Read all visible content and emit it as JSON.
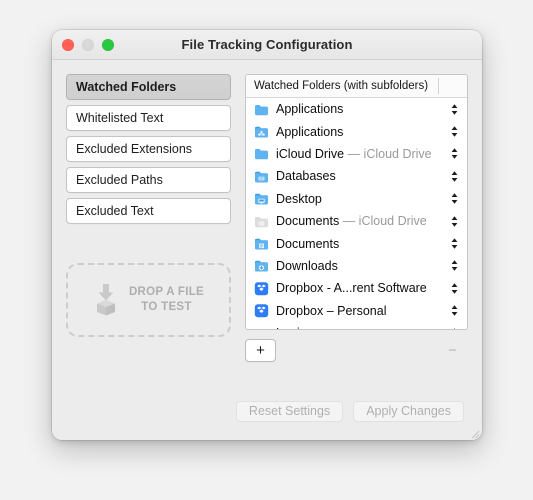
{
  "window": {
    "title": "File Tracking Configuration",
    "traffic_lights": [
      {
        "name": "close",
        "color": "#ff5f57"
      },
      {
        "name": "minimize",
        "color": "#d8d8d8"
      },
      {
        "name": "zoom",
        "color": "#28c840"
      }
    ]
  },
  "sidebar": {
    "items": [
      {
        "label": "Watched Folders",
        "selected": true
      },
      {
        "label": "Whitelisted Text",
        "selected": false
      },
      {
        "label": "Excluded Extensions",
        "selected": false
      },
      {
        "label": "Excluded Paths",
        "selected": false
      },
      {
        "label": "Excluded Text",
        "selected": false
      }
    ]
  },
  "drop_zone": {
    "icon": "download-to-box-icon",
    "line1": "DROP A FILE",
    "line2": "TO TEST"
  },
  "list": {
    "header": "Watched Folders (with subfolders)",
    "rows": [
      {
        "label": "Applications",
        "suffix": "",
        "icon": "folder-plain-icon",
        "dimmed": false
      },
      {
        "label": "Applications",
        "suffix": "",
        "icon": "folder-apps-icon",
        "dimmed": false
      },
      {
        "label": "iCloud Drive",
        "suffix": " — iCloud Drive",
        "icon": "folder-plain-icon",
        "dimmed": false
      },
      {
        "label": "Databases",
        "suffix": "",
        "icon": "folder-generic-icon",
        "dimmed": false
      },
      {
        "label": "Desktop",
        "suffix": "",
        "icon": "folder-desktop-icon",
        "dimmed": false
      },
      {
        "label": "Documents",
        "suffix": " — iCloud Drive",
        "icon": "folder-greyed-icon",
        "dimmed": true
      },
      {
        "label": "Documents",
        "suffix": "",
        "icon": "folder-documents-icon",
        "dimmed": false
      },
      {
        "label": "Downloads",
        "suffix": "",
        "icon": "folder-downloads-icon",
        "dimmed": false
      },
      {
        "label": "Dropbox - A...rent Software",
        "suffix": "",
        "icon": "dropbox-icon",
        "dimmed": false
      },
      {
        "label": "Dropbox – Personal",
        "suffix": "",
        "icon": "dropbox-icon",
        "dimmed": false
      },
      {
        "label": "Logic",
        "suffix": "",
        "icon": "folder-plain-icon",
        "dimmed": false
      }
    ],
    "stepper_icon": "up-down-chevron-icon"
  },
  "list_controls": {
    "add_label": "+",
    "remove_label": "−"
  },
  "footer": {
    "reset_label": "Reset Settings",
    "apply_label": "Apply Changes"
  },
  "colors": {
    "folder_blue": "#5eb3f0",
    "folder_blue_dark": "#3d9ee0",
    "dropbox_blue": "#2f7df6",
    "accent_selected": "#d4d4d4"
  }
}
